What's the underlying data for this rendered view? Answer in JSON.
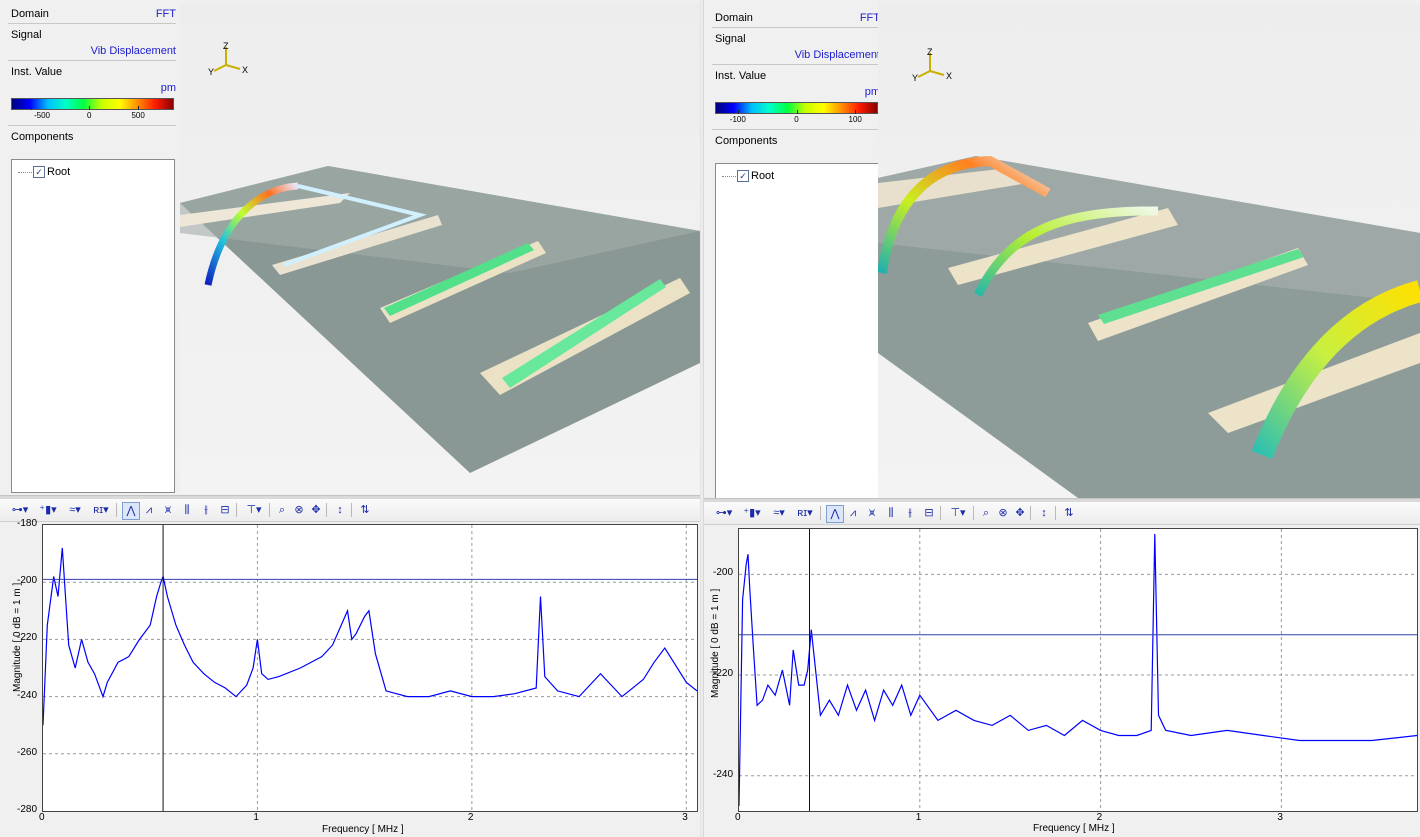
{
  "left": {
    "props": {
      "domain_key": "Domain",
      "domain_val": "FFT",
      "signal_key": "Signal",
      "signal_val": "Vib Displacement",
      "value_key": "Inst. Value",
      "unit": "pm"
    },
    "legend_ticks": [
      "-500",
      "0",
      "500"
    ],
    "components_title": "Components",
    "tree_root": "Root",
    "axis_labels": {
      "z": "Z",
      "y": "Y",
      "x": "X"
    },
    "plot": {
      "ylabel": "Magnitude [ 0 dB = 1 m ]",
      "xlabel": "Frequency [ MHz ]",
      "yticks": [
        "-180",
        "-200",
        "-220",
        "-240",
        "-260",
        "-280"
      ],
      "xticks": [
        "0",
        "1",
        "2",
        "3"
      ]
    }
  },
  "right": {
    "props": {
      "domain_key": "Domain",
      "domain_val": "FFT",
      "signal_key": "Signal",
      "signal_val": "Vib Displacement",
      "value_key": "Inst. Value",
      "unit": "pm"
    },
    "legend_ticks": [
      "-100",
      "0",
      "100"
    ],
    "components_title": "Components",
    "tree_root": "Root",
    "axis_labels": {
      "z": "Z",
      "y": "Y",
      "x": "X"
    },
    "plot": {
      "ylabel": "Magnitude [ 0 dB = 1 m ]",
      "xlabel": "Frequency [ MHz ]",
      "yticks": [
        "-200",
        "-220",
        "-240"
      ],
      "xticks": [
        "0",
        "1",
        "2",
        "3"
      ]
    }
  },
  "toolbar_icons": [
    "link-tool-icon",
    "marker-tool-icon",
    "wave-tool-icon",
    "ri-ap-tool-icon",
    "peak-view-icon",
    "peak-view-2-icon",
    "peak-view-3-icon",
    "bars-view-icon",
    "harmonic-cursor-icon",
    "average-view-icon",
    "marker-pin-icon",
    "zoom-in-icon",
    "zoom-fit-icon",
    "pan-icon",
    "scale-icon",
    "cursor-pair-icon"
  ],
  "chart_data": [
    {
      "type": "line",
      "title": "",
      "xlabel": "Frequency [ MHz ]",
      "ylabel": "Magnitude [ 0 dB = 1 m ]",
      "xlim": [
        0,
        3.05
      ],
      "ylim": [
        -280,
        -180
      ],
      "xticks": [
        0,
        1,
        2,
        3
      ],
      "yticks": [
        -180,
        -200,
        -220,
        -240,
        -260,
        -280
      ],
      "grid": true,
      "series": [
        {
          "x": [
            0,
            0.02,
            0.05,
            0.07,
            0.09,
            0.12,
            0.15,
            0.18,
            0.21,
            0.24,
            0.28,
            0.3,
            0.35,
            0.4,
            0.45,
            0.5,
            0.53,
            0.55,
            0.56,
            0.58,
            0.62,
            0.66,
            0.7,
            0.75,
            0.8,
            0.85,
            0.9,
            0.95,
            0.98,
            1.0,
            1.02,
            1.05,
            1.1,
            1.2,
            1.3,
            1.35,
            1.42,
            1.44,
            1.46,
            1.5,
            1.52,
            1.55,
            1.6,
            1.7,
            1.8,
            1.9,
            2.0,
            2.1,
            2.2,
            2.3,
            2.32,
            2.34,
            2.4,
            2.5,
            2.6,
            2.7,
            2.8,
            2.85,
            2.9,
            3.0,
            3.05
          ],
          "y": [
            -250,
            -215,
            -198,
            -205,
            -188,
            -222,
            -230,
            -220,
            -228,
            -232,
            -240,
            -235,
            -228,
            -226,
            -220,
            -215,
            -205,
            -200,
            -198,
            -205,
            -215,
            -222,
            -228,
            -232,
            -235,
            -237,
            -240,
            -236,
            -230,
            -220,
            -232,
            -234,
            -233,
            -230,
            -226,
            -222,
            -210,
            -220,
            -218,
            -212,
            -210,
            -225,
            -238,
            -240,
            -240,
            -238,
            -240,
            -240,
            -239,
            -237,
            -205,
            -233,
            -238,
            -240,
            -232,
            -240,
            -234,
            -228,
            -223,
            -235,
            -238
          ],
          "color": "#0000ff"
        }
      ],
      "h_cursor": -199,
      "v_cursor": 0.56
    },
    {
      "type": "line",
      "title": "",
      "xlabel": "Frequency [ MHz ]",
      "ylabel": "Magnitude [ 0 dB = 1 m ]",
      "xlim": [
        0,
        3.75
      ],
      "ylim": [
        -247,
        -191
      ],
      "xticks": [
        0,
        1,
        2,
        3
      ],
      "yticks": [
        -200,
        -220,
        -240
      ],
      "grid": true,
      "series": [
        {
          "x": [
            0,
            0.02,
            0.04,
            0.05,
            0.06,
            0.08,
            0.1,
            0.13,
            0.16,
            0.2,
            0.24,
            0.28,
            0.3,
            0.33,
            0.36,
            0.38,
            0.4,
            0.45,
            0.5,
            0.55,
            0.6,
            0.65,
            0.7,
            0.75,
            0.8,
            0.85,
            0.9,
            0.95,
            1.0,
            1.1,
            1.2,
            1.3,
            1.4,
            1.5,
            1.6,
            1.7,
            1.8,
            1.9,
            2.0,
            2.1,
            2.2,
            2.28,
            2.3,
            2.32,
            2.36,
            2.5,
            2.7,
            2.9,
            3.1,
            3.3,
            3.5,
            3.75
          ],
          "y": [
            -246,
            -205,
            -198,
            -196,
            -203,
            -215,
            -226,
            -225,
            -222,
            -224,
            -219,
            -226,
            -215,
            -222,
            -222,
            -219,
            -211,
            -228,
            -225,
            -228,
            -222,
            -227,
            -223,
            -229,
            -223,
            -226,
            -222,
            -228,
            -224,
            -229,
            -227,
            -229,
            -230,
            -228,
            -231,
            -230,
            -232,
            -229,
            -231,
            -232,
            -232,
            -231,
            -192,
            -228,
            -231,
            -232,
            -231,
            -232,
            -233,
            -233,
            -233,
            -232
          ],
          "color": "#0000ff"
        }
      ],
      "h_cursor": -212,
      "v_cursor": 0.39
    }
  ]
}
